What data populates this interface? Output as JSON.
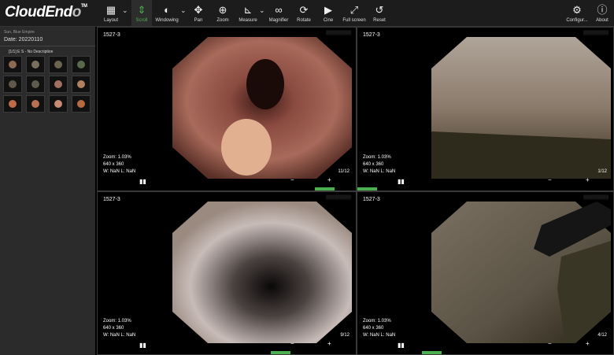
{
  "app": {
    "logo_main": "CloudEnd",
    "logo_tail": "o",
    "logo_tm": "TM"
  },
  "toolbar": {
    "layout": "Layout",
    "scroll": "Scroll",
    "windowing": "Windowing",
    "pan": "Pan",
    "zoom": "Zoom",
    "measure": "Measure",
    "magnifier": "Magnifier",
    "rotate": "Rotate",
    "cine": "Cine",
    "fullscreen": "Full screen",
    "reset": "Reset",
    "configure": "Configur...",
    "about": "About"
  },
  "sidebar": {
    "patient_name": "Sun, Blue Empire",
    "date": "Date: 20220110",
    "series_label": "[1/1] E S - No Description"
  },
  "viewports": [
    {
      "id": "1527-3",
      "zoom": "Zoom: 1.03%",
      "size": "640 x 360",
      "wl": "W: NaN L: NaN",
      "count": "11/12"
    },
    {
      "id": "1527-3",
      "zoom": "Zoom: 1.03%",
      "size": "640 x 360",
      "wl": "W: NaN L: NaN",
      "count": "1/12"
    },
    {
      "id": "1527-3",
      "zoom": "Zoom: 1.03%",
      "size": "640 x 360",
      "wl": "W: NaN L: NaN",
      "count": "9/12"
    },
    {
      "id": "1527-3",
      "zoom": "Zoom: 1.03%",
      "size": "640 x 360",
      "wl": "W: NaN L: NaN",
      "count": "4/12"
    }
  ],
  "controls": {
    "pause": "▮▮",
    "minus": "−",
    "plus": "+"
  },
  "colors": {
    "accent": "#4caf50",
    "toolbar_bg": "#1c1c1c",
    "sidebar_bg": "#2b2b2b"
  }
}
